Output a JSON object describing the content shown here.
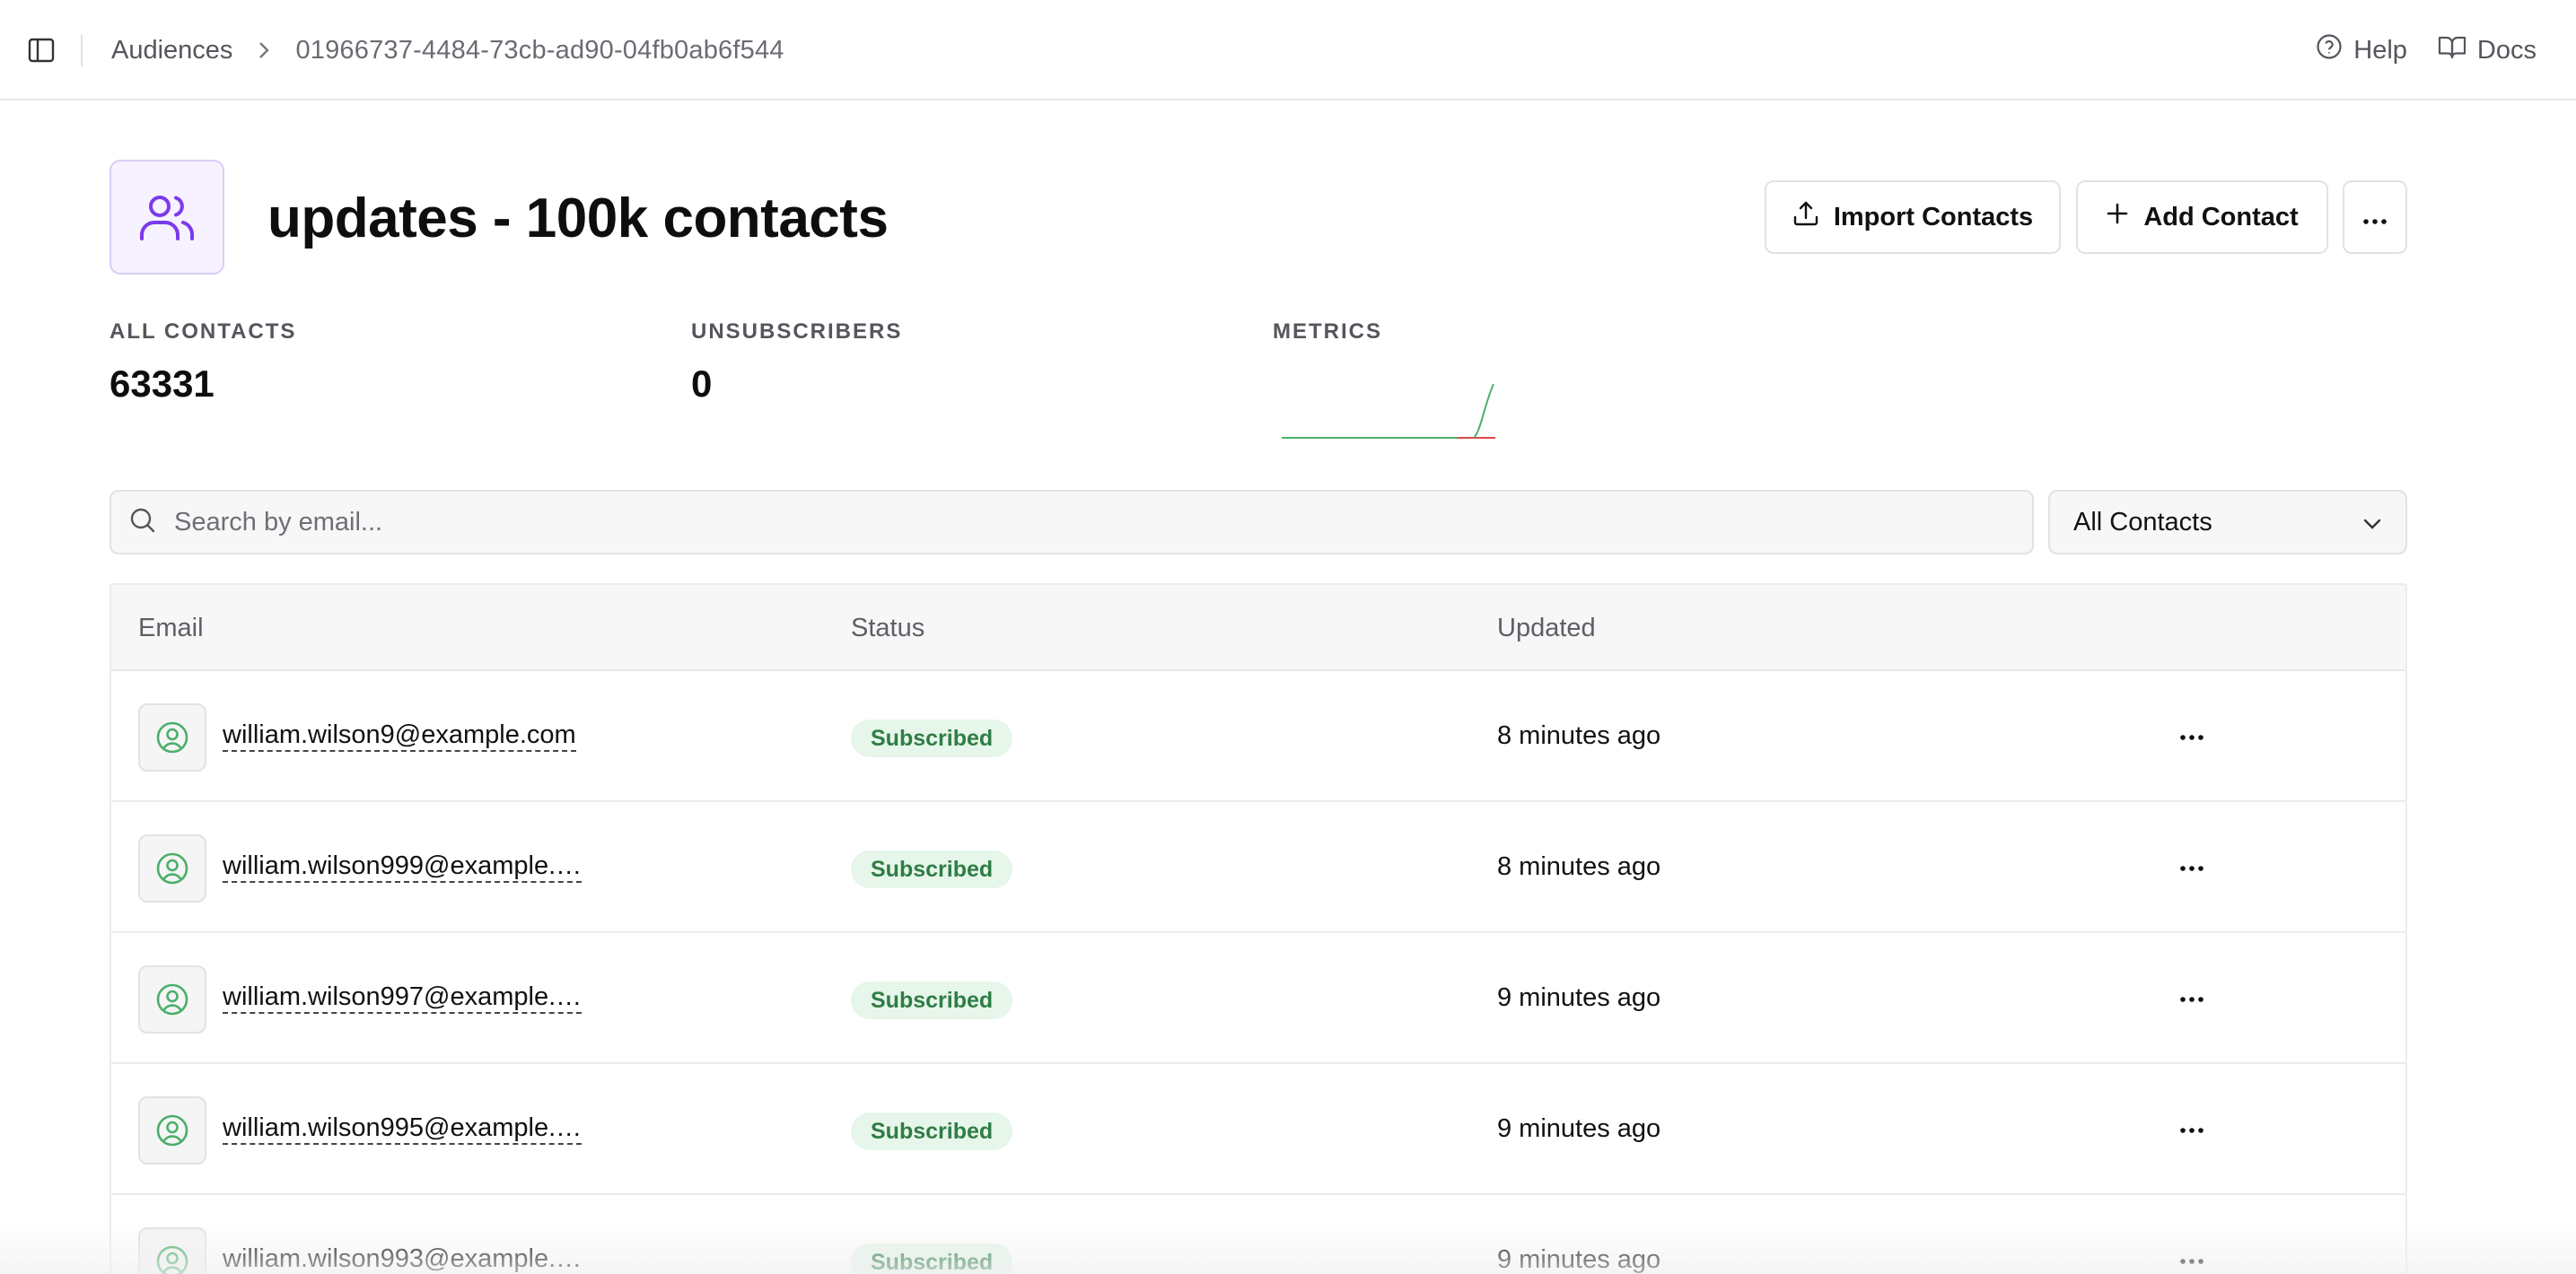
{
  "breadcrumb": {
    "parent": "Audiences",
    "current": "01966737-4484-73cb-ad90-04fb0ab6f544"
  },
  "top_links": {
    "help": "Help",
    "docs": "Docs"
  },
  "header": {
    "title": "updates - 100k contacts",
    "import_label": "Import Contacts",
    "add_label": "Add Contact"
  },
  "stats": {
    "all_contacts_label": "ALL CONTACTS",
    "all_contacts_value": "63331",
    "unsubscribers_label": "UNSUBSCRIBERS",
    "unsubscribers_value": "0",
    "metrics_label": "METRICS"
  },
  "search": {
    "placeholder": "Search by email...",
    "value": ""
  },
  "filter": {
    "selected": "All Contacts"
  },
  "table": {
    "columns": [
      "Email",
      "Status",
      "Updated"
    ],
    "rows": [
      {
        "email": "william.wilson9@example.com",
        "status": "Subscribed",
        "updated": "8 minutes ago"
      },
      {
        "email": "william.wilson999@example.…",
        "status": "Subscribed",
        "updated": "8 minutes ago"
      },
      {
        "email": "william.wilson997@example.…",
        "status": "Subscribed",
        "updated": "9 minutes ago"
      },
      {
        "email": "william.wilson995@example.…",
        "status": "Subscribed",
        "updated": "9 minutes ago"
      },
      {
        "email": "william.wilson993@example.…",
        "status": "Subscribed",
        "updated": "9 minutes ago"
      }
    ]
  },
  "colors": {
    "accent_purple": "#7c3aed",
    "status_green": "#2f7d45",
    "status_green_bg": "#e6f6ea",
    "sparkline_green": "#4caf6a",
    "sparkline_red": "#e04848"
  }
}
